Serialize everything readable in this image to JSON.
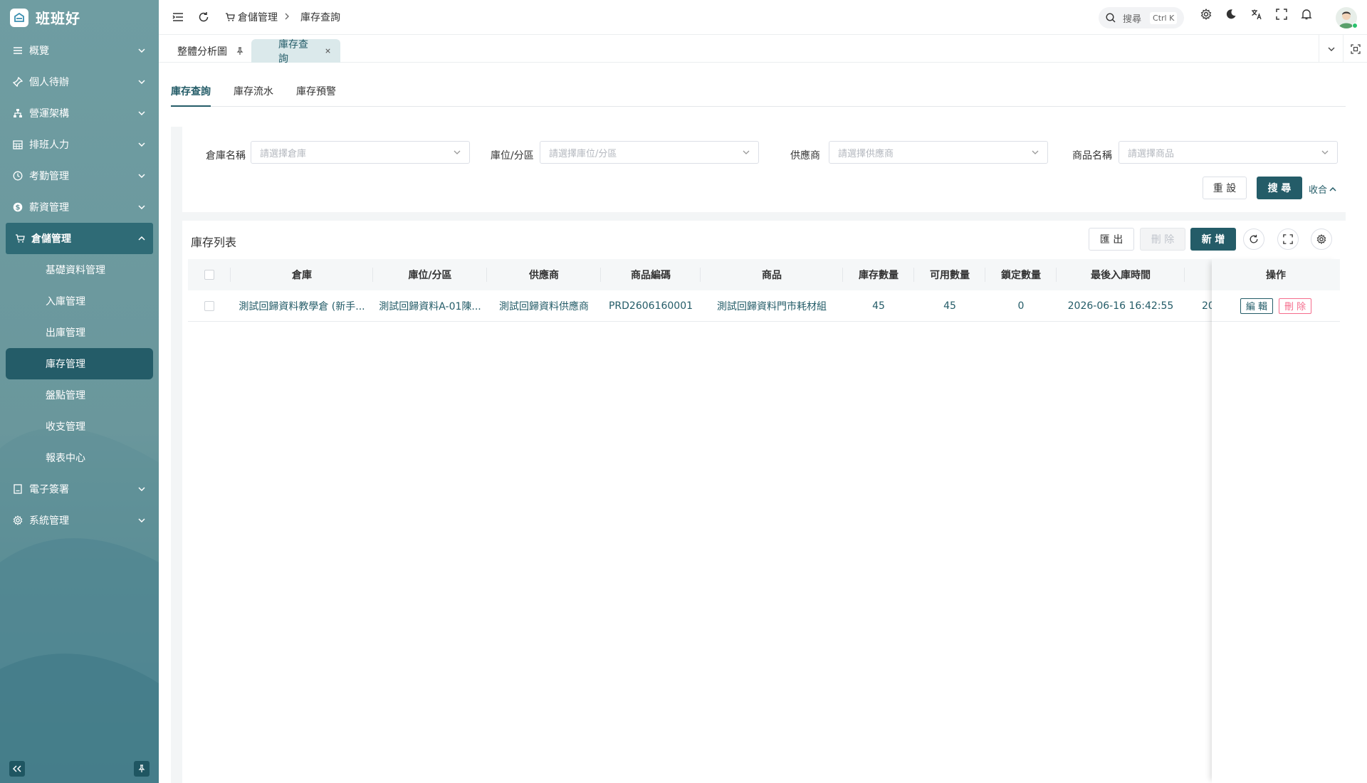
{
  "app": {
    "name": "班班好"
  },
  "sidebar": {
    "menu": [
      {
        "label": "概覽",
        "icon": "list-icon"
      },
      {
        "label": "個人待辦",
        "icon": "pin-icon"
      },
      {
        "label": "營運架構",
        "icon": "org-chart-icon"
      },
      {
        "label": "排班人力",
        "icon": "calendar-icon"
      },
      {
        "label": "考勤管理",
        "icon": "clock-icon"
      },
      {
        "label": "薪資管理",
        "icon": "dollar-icon"
      },
      {
        "label": "倉儲管理",
        "icon": "cart-icon"
      }
    ],
    "submenu": [
      {
        "label": "基礎資料管理"
      },
      {
        "label": "入庫管理"
      },
      {
        "label": "出庫管理"
      },
      {
        "label": "庫存管理"
      },
      {
        "label": "盤點管理"
      },
      {
        "label": "收支管理"
      },
      {
        "label": "報表中心"
      }
    ],
    "menu_after": [
      {
        "label": "電子簽署",
        "icon": "document-icon"
      },
      {
        "label": "系統管理",
        "icon": "gear-icon"
      }
    ]
  },
  "header": {
    "breadcrumb": [
      "倉儲管理",
      "庫存查詢"
    ],
    "search_label": "搜尋",
    "search_shortcut": "Ctrl K"
  },
  "tabs": [
    {
      "label": "整體分析圖"
    },
    {
      "label": "庫存查詢"
    }
  ],
  "subtabs": [
    {
      "label": "庫存查詢"
    },
    {
      "label": "庫存流水"
    },
    {
      "label": "庫存預警"
    }
  ],
  "filters": [
    {
      "label": "倉庫名稱",
      "placeholder": "請選擇倉庫"
    },
    {
      "label": "庫位/分區",
      "placeholder": "請選擇庫位/分區"
    },
    {
      "label": "供應商",
      "placeholder": "請選擇供應商"
    },
    {
      "label": "商品名稱",
      "placeholder": "請選擇商品"
    }
  ],
  "filter_actions": {
    "reset": "重 設",
    "search": "搜 尋",
    "collapse": "收合"
  },
  "list": {
    "title": "庫存列表",
    "export": "匯 出",
    "delete": "刪 除",
    "add": "新 增",
    "columns": [
      "倉庫",
      "庫位/分區",
      "供應商",
      "商品編碼",
      "商品",
      "庫存數量",
      "可用數量",
      "鎖定數量",
      "最後入庫時間"
    ],
    "action_header": "操作",
    "rows": [
      {
        "warehouse": "測試回歸資料教學倉 (新手...",
        "location": "測試回歸資料A-01陳...",
        "supplier": "測試回歸資料供應商",
        "code": "PRD2606160001",
        "product": "測試回歸資料門市耗材組",
        "stock": "45",
        "available": "45",
        "locked": "0",
        "last_in": "2026-06-16 16:42:55",
        "extra": "20",
        "edit": "編 輯",
        "del": "刪 除"
      }
    ]
  },
  "colors": {
    "primary": "#245c68",
    "danger": "#f56c8c",
    "sidebar": "#6a979c"
  }
}
